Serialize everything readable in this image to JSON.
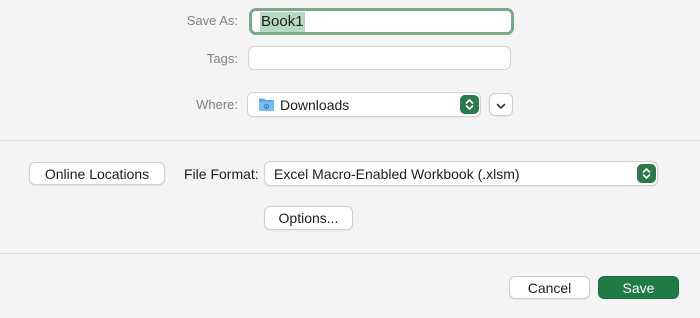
{
  "save_as": {
    "label": "Save As:",
    "value": "Book1"
  },
  "tags": {
    "label": "Tags:",
    "placeholder": ""
  },
  "where": {
    "label": "Where:",
    "value": "Downloads"
  },
  "online_locations": {
    "label": "Online Locations"
  },
  "file_format": {
    "label": "File Format:",
    "value": "Excel Macro-Enabled Workbook (.xlsm)"
  },
  "options": {
    "label": "Options..."
  },
  "footer": {
    "cancel_label": "Cancel",
    "save_label": "Save"
  },
  "colors": {
    "accent": "#1f7a45",
    "selection": "#b7d9c2",
    "focus_ring": "#7aa98a"
  }
}
